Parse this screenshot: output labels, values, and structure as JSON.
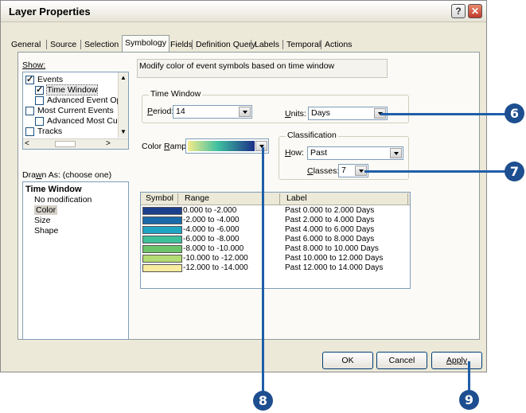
{
  "window": {
    "title": "Layer Properties",
    "help_label": "?",
    "close_label": "✕"
  },
  "tabs": [
    "General",
    "Source",
    "Selection",
    "Symbology",
    "Fields",
    "Definition Query",
    "Labels",
    "Temporal",
    "Actions"
  ],
  "active_tab": "Symbology",
  "show_label": "Show:",
  "tree": [
    {
      "label": "Events",
      "checked": true
    },
    {
      "label": "Time Window",
      "checked": true
    },
    {
      "label": "Advanced Event Opti",
      "checked": false
    },
    {
      "label": "Most Current Events",
      "checked": false
    },
    {
      "label": "Advanced Most Curre",
      "checked": false
    },
    {
      "label": "Tracks",
      "checked": false
    }
  ],
  "description": "Modify color of event symbols based on time window",
  "time_window": {
    "title": "Time Window",
    "period_label": "Period:",
    "period_value": "14",
    "units_label": "Units:",
    "units_value": "Days"
  },
  "color_ramp_label": "Color Ramp:",
  "classification": {
    "title": "Classification",
    "how_label": "How:",
    "how_value": "Past",
    "classes_label": "Classes:",
    "classes_value": "7"
  },
  "drawn_as": {
    "label": "Drawn As: (choose one)",
    "heading": "Time Window",
    "options": [
      "No modification",
      "Color",
      "Size",
      "Shape"
    ],
    "selected": "Color"
  },
  "table": {
    "headers": [
      "Symbol",
      "Range",
      "Label"
    ],
    "rows": [
      {
        "color": "#1c3f8c",
        "range": "0.000 to -2.000",
        "label": "Past 0.000 to 2.000 Days"
      },
      {
        "color": "#1a6aaa",
        "range": "-2.000 to -4.000",
        "label": "Past 2.000 to 4.000 Days"
      },
      {
        "color": "#1fa4c4",
        "range": "-4.000 to -6.000",
        "label": "Past 4.000 to 6.000 Days"
      },
      {
        "color": "#3fbf9a",
        "range": "-6.000 to -8.000",
        "label": "Past 6.000 to 8.000 Days"
      },
      {
        "color": "#6cc46a",
        "range": "-8.000 to -10.000",
        "label": "Past 8.000 to 10.000 Days"
      },
      {
        "color": "#b3dc74",
        "range": "-10.000 to -12.000",
        "label": "Past 10.000 to 12.000 Days"
      },
      {
        "color": "#f8eca0",
        "range": "-12.000 to -14.000",
        "label": "Past 12.000 to 14.000 Days"
      }
    ]
  },
  "buttons": {
    "ok": "OK",
    "cancel": "Cancel",
    "apply": "Apply"
  },
  "callouts": [
    "6",
    "7",
    "8",
    "9"
  ],
  "colors": {
    "callout": "#1d4e8f",
    "ramp_start": "#f4ec8c",
    "ramp_mid": "#3fbfa0",
    "ramp_end": "#1c2f88"
  }
}
